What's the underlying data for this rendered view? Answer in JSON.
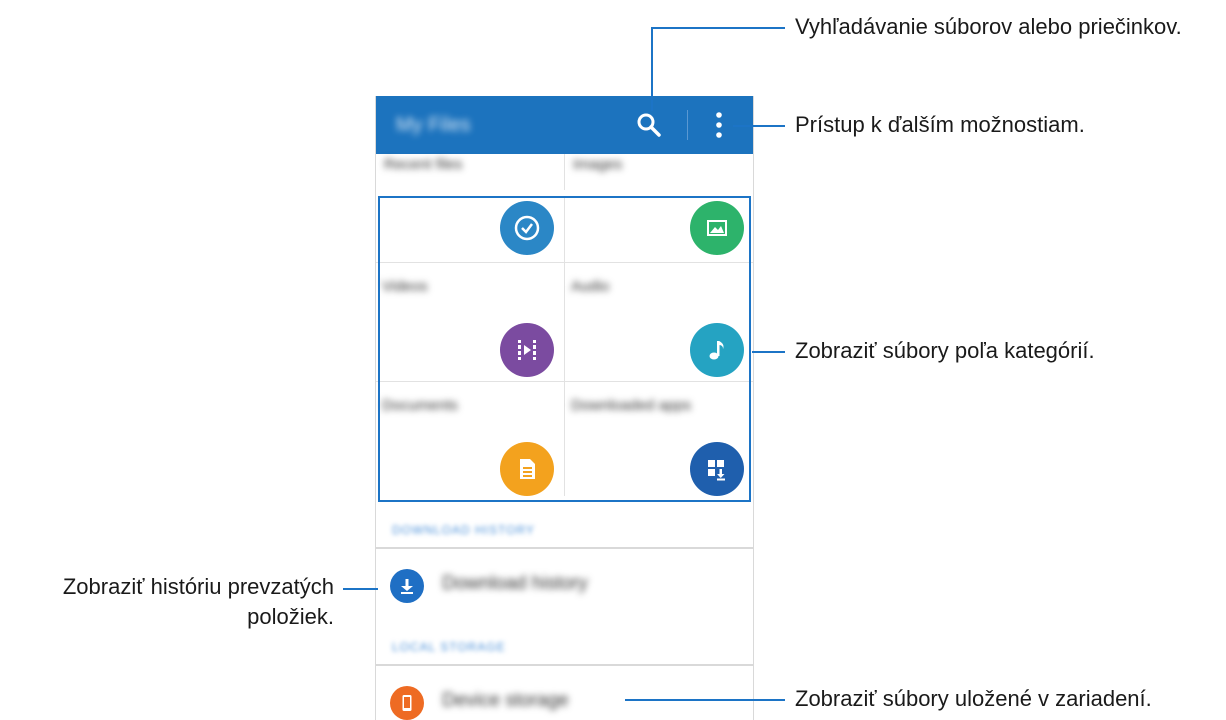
{
  "app": {
    "title": "My Files",
    "top_row": [
      "Recent files",
      "Images"
    ],
    "categories": [
      {
        "label": "",
        "icon": "clock-icon",
        "color": "#2b87c6"
      },
      {
        "label": "",
        "icon": "image-icon",
        "color": "#2db36b"
      },
      {
        "label": "Videos",
        "icon": "video-icon",
        "color": "#7b4ba0"
      },
      {
        "label": "Audio",
        "icon": "music-note-icon",
        "color": "#25a3c2"
      },
      {
        "label": "Documents",
        "icon": "document-icon",
        "color": "#f3a21e"
      },
      {
        "label": "Downloaded apps",
        "icon": "downloaded-apps-icon",
        "color": "#1f5fad"
      }
    ],
    "download_section_header": "DOWNLOAD HISTORY",
    "download_history_label": "Download history",
    "local_section_header": "LOCAL STORAGE",
    "device_storage_label": "Device storage",
    "accent": "#1c73be"
  },
  "annotations": {
    "search": "Vyhľadávanie súborov alebo priečinkov.",
    "more": "Prístup k ďalším možnostiam.",
    "categories": "Zobraziť súbory poľa kategórií.",
    "download_history_line1": "Zobraziť históriu prevzatých",
    "download_history_line2": "položiek.",
    "device_storage": "Zobraziť súbory uložené v zariadení."
  }
}
